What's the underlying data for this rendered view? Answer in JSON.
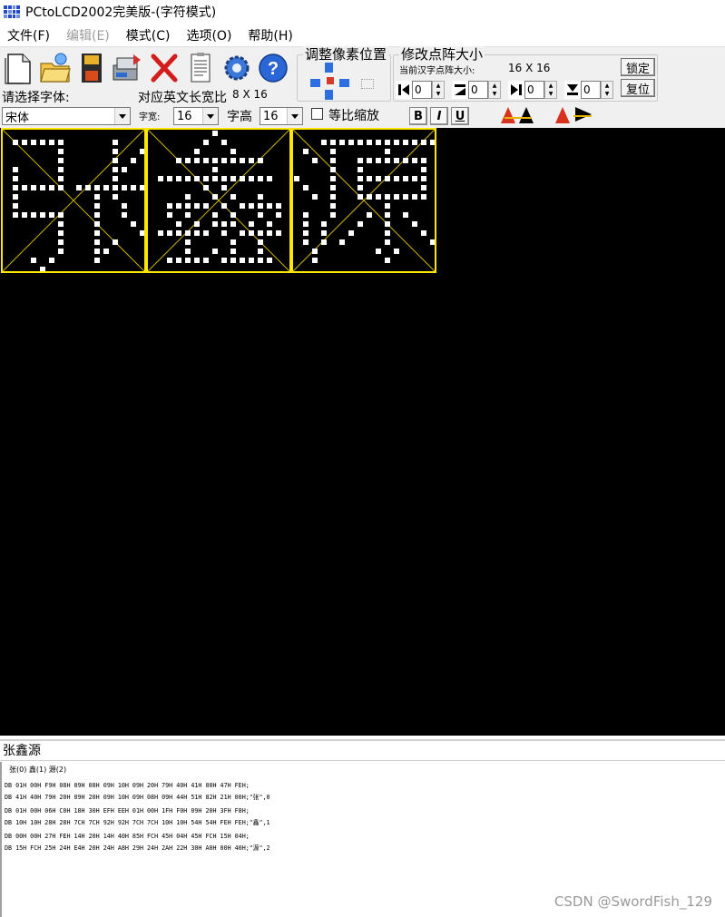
{
  "window": {
    "title": "PCtoLCD2002完美版-(字符模式)"
  },
  "menu": [
    "文件(F)",
    "编辑(E)",
    "模式(C)",
    "选项(O)",
    "帮助(H)"
  ],
  "menu_disabled_index": 1,
  "toolbar": {
    "icons": [
      "new-file-icon",
      "open-folder-icon",
      "save-icon",
      "batch-generate-icon",
      "delete-icon",
      "notes-icon",
      "settings-gear-icon",
      "help-icon"
    ]
  },
  "font_panel": {
    "select_font_label": "请选择字体:",
    "font_value": "宋体",
    "aspect_label": "对应英文长宽比",
    "aspect_value": "8 X 16",
    "width_label": "字宽:",
    "width_value": "16",
    "height_label": "字高",
    "height_value": "16",
    "proportional_label": "等比缩放",
    "bold_label": "B",
    "italic_label": "I",
    "underline_label": "U"
  },
  "pixel_adjust": {
    "title": "调整像素位置"
  },
  "matrix_size": {
    "title": "修改点阵大小",
    "current_label": "当前汉字点阵大小:",
    "current_value": "16 X 16",
    "lock_label": "锁定",
    "reset_label": "复位",
    "spinners": [
      "0",
      "0",
      "0",
      "0"
    ]
  },
  "glyphs": [
    {
      "char": "张",
      "rows": [
        "0000000000000000",
        "0111111000001000",
        "0000001000001001",
        "0000001000001010",
        "0100001000001100",
        "0100001000001000",
        "0111111011111111",
        "0100000000101000",
        "0100000000100100",
        "0111111000100100",
        "0000001000100010",
        "0000001000100001",
        "0000001000101000",
        "0000001000110000",
        "0001010000100000",
        "0000100000000000"
      ]
    },
    {
      "char": "鑫",
      "rows": [
        "0000000100000000",
        "0000001010000000",
        "0000010001000000",
        "0001111111111000",
        "0000000100000000",
        "0111111111111100",
        "0000001010000000",
        "0000100101001000",
        "0011111010111110",
        "0010100101001010",
        "0001010111010100",
        "0111111010111110",
        "0000100001001000",
        "0000100101001000",
        "0011111011111100",
        "0000000000000000"
      ]
    },
    {
      "char": "源",
      "rows": [
        "0000000000000000",
        "0001111111111111",
        "0100100000100000",
        "0010100111111110",
        "0000100100000010",
        "1000100111111110",
        "0100100100000010",
        "0010100111111110",
        "0000100000100000",
        "0100100010101000",
        "0101000100100100",
        "0101001000100010",
        "0101010000100001",
        "0010000001010000",
        "0010000000100000",
        "0000000000000000"
      ]
    }
  ],
  "input_text": "张鑫源",
  "output": {
    "tabs": "张(0) 鑫(1) 源(2)",
    "lines": [
      "DB 01H 00H F9H 08H 09H 08H 09H 10H 09H 20H 79H 40H 41H 00H 47H FEH;",
      "DB 41H 40H 79H 20H 09H 20H 09H 10H 09H 08H 09H 44H 51H 82H 21H 00H;\"张\",0",
      "",
      "DB 01H 00H 06H C0H 18H 30H EFH EEH 01H 00H 1FH F0H 09H 20H 3FH F8H;",
      "DB 10H 10H 28H 28H 7CH 7CH 92H 92H 7CH 7CH 10H 10H 54H 54H FEH FEH;\"鑫\",1",
      "",
      "DB 00H 00H 27H FEH 14H 20H 14H 40H 85H FCH 45H 04H 45H FCH 15H 04H;",
      "DB 15H FCH 25H 24H E4H 20H 24H A8H 29H 24H 2AH 22H 30H A0H 00H 40H;\"源\",2"
    ]
  },
  "watermark": "CSDN @SwordFish_129"
}
